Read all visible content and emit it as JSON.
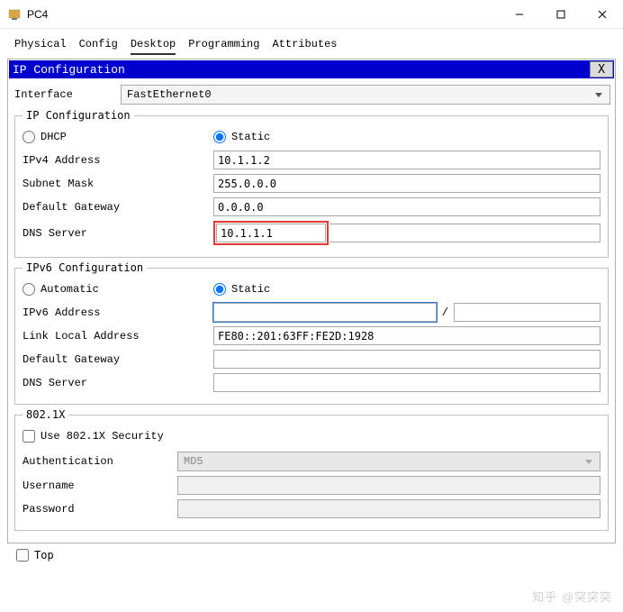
{
  "window": {
    "title": "PC4"
  },
  "tabs": {
    "items": [
      "Physical",
      "Config",
      "Desktop",
      "Programming",
      "Attributes"
    ],
    "active_index": 2
  },
  "panel": {
    "title": "IP Configuration",
    "close": "X"
  },
  "interface": {
    "label": "Interface",
    "selected": "FastEthernet0"
  },
  "ipcfg": {
    "legend": "IP Configuration",
    "dhcp_label": "DHCP",
    "static_label": "Static",
    "mode": "static",
    "ipv4_label": "IPv4 Address",
    "ipv4_value": "10.1.1.2",
    "mask_label": "Subnet Mask",
    "mask_value": "255.0.0.0",
    "gw_label": "Default Gateway",
    "gw_value": "0.0.0.0",
    "dns_label": "DNS Server",
    "dns_value": "10.1.1.1"
  },
  "ip6cfg": {
    "legend": "IPv6 Configuration",
    "auto_label": "Automatic",
    "static_label": "Static",
    "mode": "static",
    "addr_label": "IPv6 Address",
    "addr_value": "",
    "prefix_value": "",
    "linklocal_label": "Link Local Address",
    "linklocal_value": "FE80::201:63FF:FE2D:1928",
    "gw_label": "Default Gateway",
    "gw_value": "",
    "dns_label": "DNS Server",
    "dns_value": ""
  },
  "dot1x": {
    "legend": "802.1X",
    "use_label": "Use 802.1X Security",
    "use_checked": false,
    "auth_label": "Authentication",
    "auth_value": "MD5",
    "user_label": "Username",
    "user_value": "",
    "pass_label": "Password",
    "pass_value": ""
  },
  "bottom": {
    "top_label": "Top",
    "top_checked": false
  },
  "watermark": "知乎 @突突突"
}
